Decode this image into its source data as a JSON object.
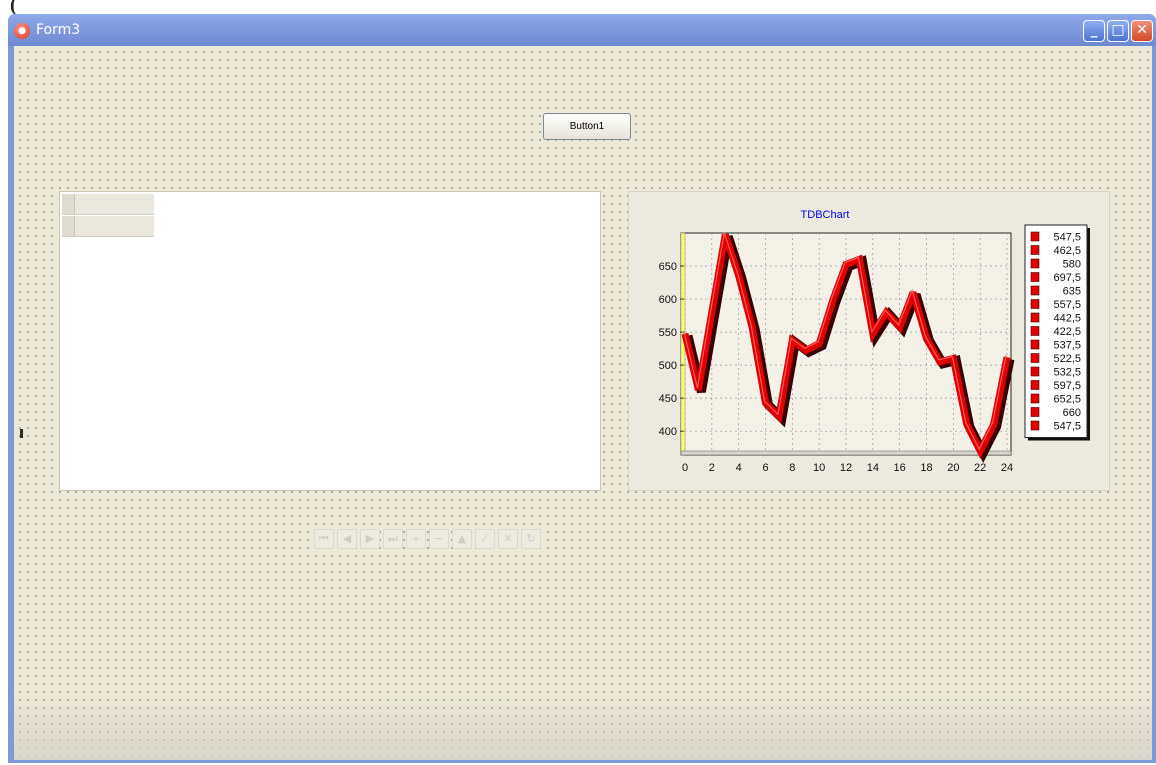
{
  "page_top": {
    "text": "("
  },
  "window": {
    "title": "Form3",
    "app_icon": "delphi-app-icon"
  },
  "window_controls": {
    "minimize": "minimize-icon",
    "maximize": "maximize-icon",
    "close": "close-icon"
  },
  "form": {
    "button1_label": "Button1"
  },
  "navigator": {
    "icons": [
      "first-icon",
      "prior-icon",
      "next-icon",
      "last-icon",
      "insert-icon",
      "delete-icon",
      "edit-icon",
      "post-icon",
      "cancel-icon",
      "refresh-icon"
    ]
  },
  "chart_data": {
    "type": "line",
    "title": "TDBChart",
    "title_color": "#0000ff",
    "series_color": "#e00000",
    "style": "3d-ribbon",
    "x": [
      0,
      1,
      2,
      3,
      4,
      5,
      6,
      7,
      8,
      9,
      10,
      11,
      12,
      13,
      14,
      15,
      16,
      17,
      18,
      19,
      20,
      21,
      22,
      23,
      24
    ],
    "values": [
      547.5,
      462.5,
      580,
      697.5,
      635,
      557.5,
      442.5,
      422.5,
      537.5,
      522.5,
      532.5,
      597.5,
      652.5,
      660,
      547.5,
      580,
      557.5,
      610,
      540,
      505,
      510,
      410,
      370,
      410,
      512
    ],
    "xlim": [
      0,
      24
    ],
    "ylim": [
      370,
      700
    ],
    "x_ticks": [
      "0",
      "2",
      "4",
      "6",
      "8",
      "10",
      "12",
      "14",
      "16",
      "18",
      "20",
      "22",
      "24"
    ],
    "y_ticks": [
      "400",
      "450",
      "500",
      "550",
      "600",
      "650"
    ],
    "legend": [
      "547,5",
      "462,5",
      "580",
      "697,5",
      "635",
      "557,5",
      "442,5",
      "422,5",
      "537,5",
      "522,5",
      "532,5",
      "597,5",
      "652,5",
      "660",
      "547,5"
    ],
    "legend_position": "right",
    "grid": true
  }
}
